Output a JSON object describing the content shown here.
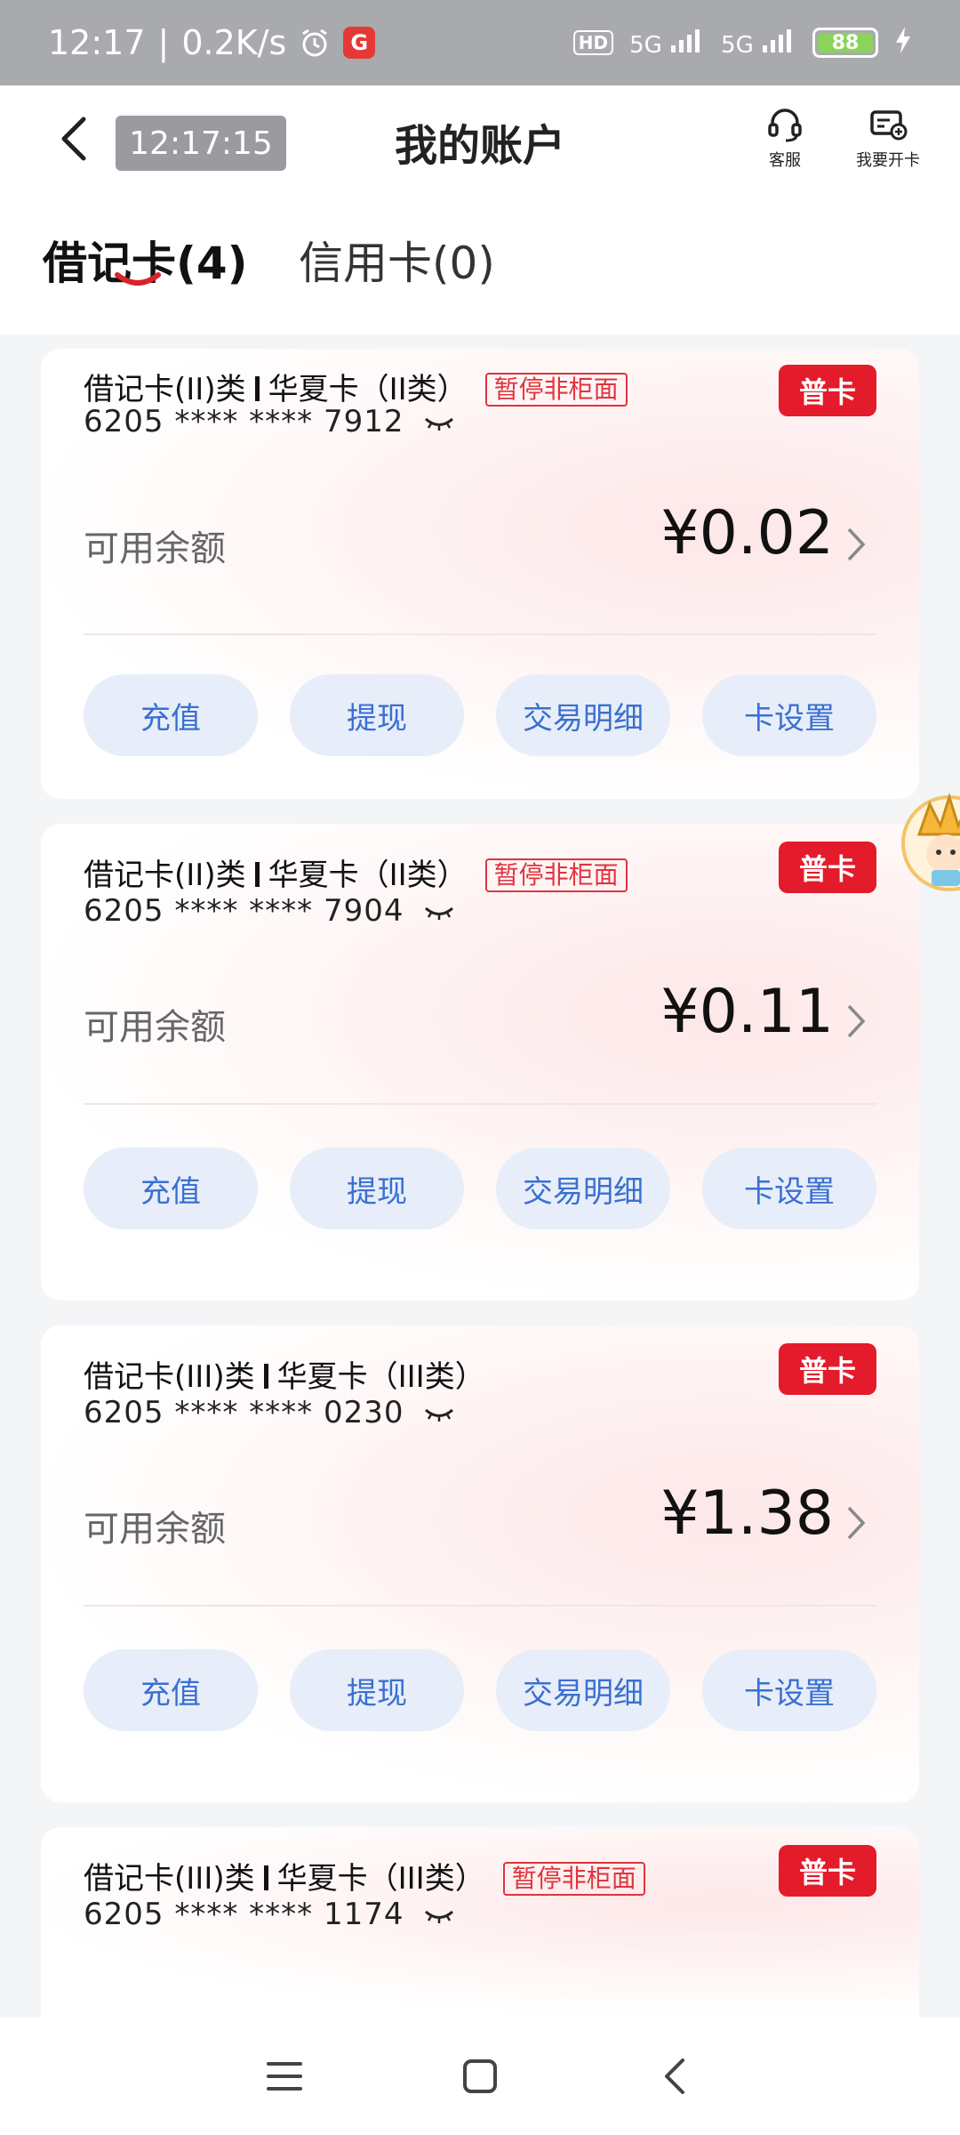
{
  "status_bar": {
    "time": "12:17",
    "net_speed": "0.2K/s",
    "hd_label": "HD",
    "signal1": "5G",
    "signal2": "5G",
    "battery": "88"
  },
  "header": {
    "timestamp": "12:17:15",
    "title": "我的账户",
    "service_label": "客服",
    "open_card_label": "我要开卡"
  },
  "tabs": [
    {
      "label": "借记卡(4)",
      "active": true
    },
    {
      "label": "信用卡(0)",
      "active": false
    }
  ],
  "cards": [
    {
      "title_left": "借记卡(II)类",
      "title_right": "华夏卡（II类）",
      "status_tag": "暂停非柜面",
      "badge": "普卡",
      "number": "6205 **** **** 7912",
      "balance_label": "可用余额",
      "balance": "¥0.02",
      "actions": [
        "充值",
        "提现",
        "交易明细",
        "卡设置"
      ]
    },
    {
      "title_left": "借记卡(II)类",
      "title_right": "华夏卡（II类）",
      "status_tag": "暂停非柜面",
      "badge": "普卡",
      "number": "6205 **** **** 7904",
      "balance_label": "可用余额",
      "balance": "¥0.11",
      "actions": [
        "充值",
        "提现",
        "交易明细",
        "卡设置"
      ]
    },
    {
      "title_left": "借记卡(III)类",
      "title_right": "华夏卡（III类）",
      "status_tag": "",
      "badge": "普卡",
      "number": "6205 **** **** 0230",
      "balance_label": "可用余额",
      "balance": "¥1.38",
      "actions": [
        "充值",
        "提现",
        "交易明细",
        "卡设置"
      ]
    },
    {
      "title_left": "借记卡(III)类",
      "title_right": "华夏卡（III类）",
      "status_tag": "暂停非柜面",
      "badge": "普卡",
      "number": "6205 **** **** 1174",
      "balance_label": "",
      "balance": "",
      "actions": []
    }
  ],
  "icons": {
    "back": "chevron-left-icon",
    "service": "headset-icon",
    "open_card": "card-plus-icon",
    "eye": "eye-closed-icon",
    "nav_menu": "menu-icon",
    "nav_home": "home-square-icon",
    "nav_back": "back-triangle-icon"
  },
  "colors": {
    "badge_red": "#e31b2b",
    "action_bg": "#e7eef9",
    "action_text": "#3b6fd1",
    "tab_underline": "#d8232a"
  }
}
